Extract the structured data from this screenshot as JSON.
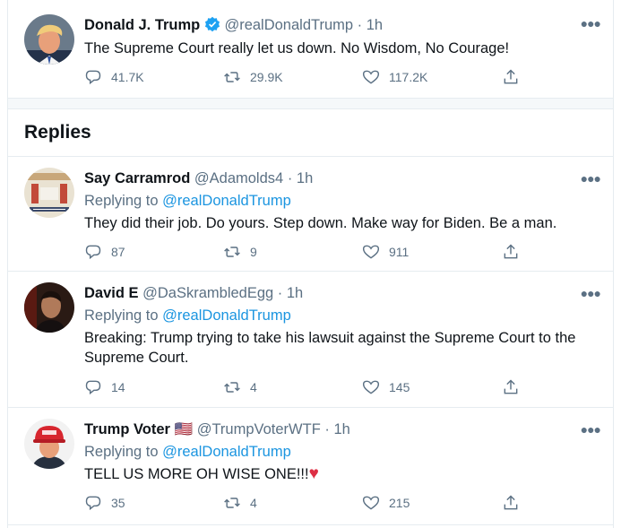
{
  "main_tweet": {
    "name": "Donald J. Trump",
    "handle": "@realDonaldTrump",
    "time": "· 1h",
    "text": "The Supreme Court really let us down. No Wisdom, No Courage!",
    "replies": "41.7K",
    "retweets": "29.9K",
    "likes": "117.2K",
    "avatar": "man-orange-hair-avatar"
  },
  "section": {
    "title": "Replies"
  },
  "replies": [
    {
      "name": "Say Carramrod",
      "handle": "@Adamolds4",
      "time": "· 1h",
      "replying_prefix": "Replying to ",
      "replying_to": "@realDonaldTrump",
      "text": "They did their job. Do yours.  Step down.  Make way for Biden.  Be a man.",
      "replies": "87",
      "retweets": "9",
      "likes": "911",
      "avatar": "social-distance-sign-avatar"
    },
    {
      "name": "David E",
      "handle": "@DaSkrambledEgg",
      "time": "· 1h",
      "replying_prefix": "Replying to ",
      "replying_to": "@realDonaldTrump",
      "text": "Breaking: Trump trying to take his lawsuit against the Supreme Court to the Supreme Court.",
      "replies": "14",
      "retweets": "4",
      "likes": "145",
      "avatar": "dark-portrait-avatar"
    },
    {
      "name": "Trump Voter",
      "flag": "🇺🇸",
      "handle": "@TrumpVoterWTF",
      "time": "· 1h",
      "replying_prefix": "Replying to ",
      "replying_to": "@realDonaldTrump",
      "text": "TELL US MORE OH WISE ONE!!!",
      "emoji": "♥",
      "replies": "35",
      "retweets": "4",
      "likes": "215",
      "avatar": "red-cap-avatar"
    }
  ],
  "colors": {
    "link": "#1b95e0",
    "muted": "#5b7083",
    "verified": "#1da1f2",
    "heart_emoji": "#dd2e44"
  }
}
